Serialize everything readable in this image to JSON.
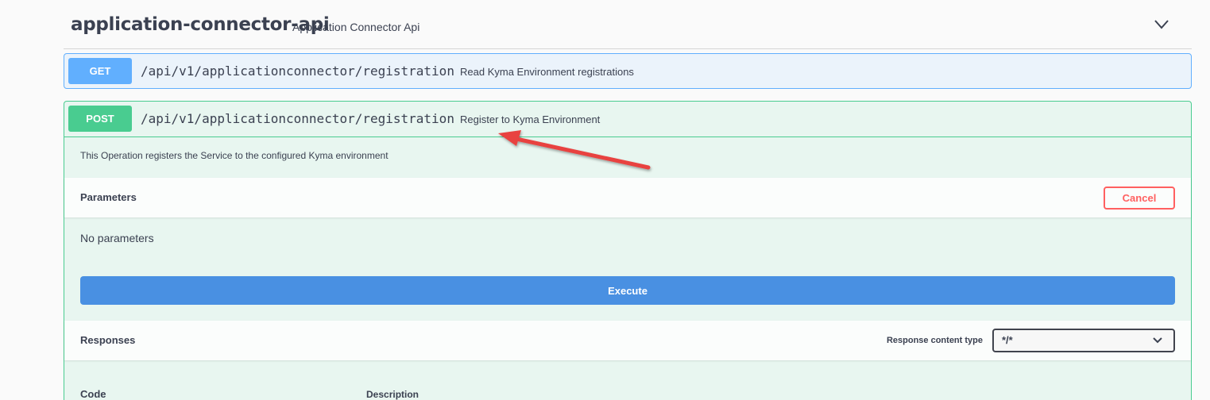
{
  "tag": {
    "name": "application-connector-api",
    "description": "Application Connector Api",
    "chevron_icon": "chevron-down-icon"
  },
  "operations": [
    {
      "method": "GET",
      "path": "/api/v1/applicationconnector/registration",
      "summary": "Read Kyma Environment registrations",
      "color": "#61affe"
    },
    {
      "method": "POST",
      "path": "/api/v1/applicationconnector/registration",
      "summary": "Register to Kyma Environment",
      "color": "#49cc90",
      "description": "This Operation registers the Service to the configured Kyma environment",
      "parameters_title": "Parameters",
      "cancel_label": "Cancel",
      "no_params": "No parameters",
      "execute_label": "Execute",
      "responses_title": "Responses",
      "response_content_type_label": "Response content type",
      "response_content_type_value": "*/*",
      "table_headers": [
        "Code",
        "Description"
      ]
    }
  ],
  "colors": {
    "get": "#61affe",
    "post": "#49cc90",
    "execute": "#4990e2",
    "cancel": "#ff6060",
    "annotation_arrow": "#e8423f"
  },
  "annotation": {
    "icon": "red-arrow-annotation"
  }
}
